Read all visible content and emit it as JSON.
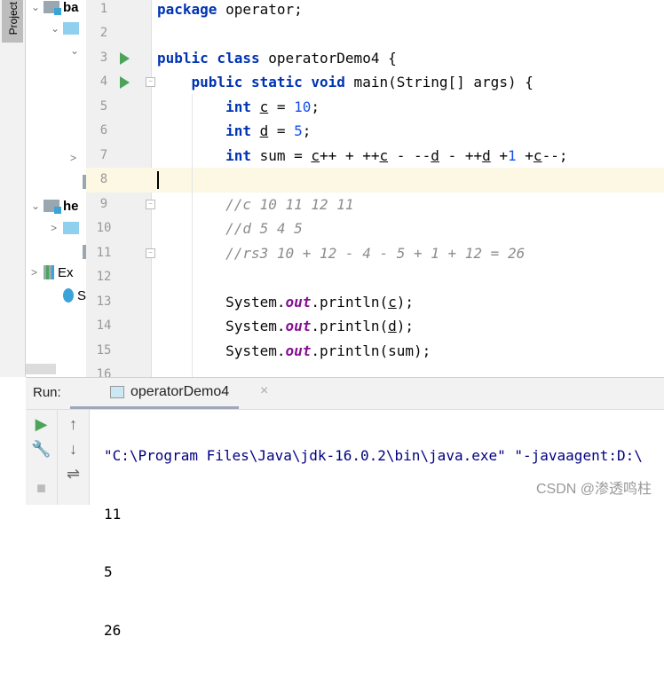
{
  "sidebar": {
    "project_tab": "Project",
    "tree": [
      {
        "label": "ba",
        "bold": true
      },
      {
        "label": "",
        "bold": false
      },
      {
        "label": "",
        "bold": false
      },
      {
        "label": "",
        "bold": false
      },
      {
        "label": "",
        "bold": false
      },
      {
        "label": "he",
        "bold": true
      },
      {
        "label": "",
        "bold": false
      },
      {
        "label": "",
        "bold": false
      },
      {
        "label": "Ex",
        "bold": false
      },
      {
        "label": "Sc",
        "bold": false
      }
    ]
  },
  "editor": {
    "current_line": 8,
    "run_lines": [
      3,
      4
    ],
    "lines": [
      [
        {
          "t": "package",
          "c": "kw"
        },
        {
          "t": " operator;"
        }
      ],
      [],
      [
        {
          "t": "public class",
          "c": "kw"
        },
        {
          "t": " operatorDemo4 {"
        }
      ],
      [
        {
          "t": "    "
        },
        {
          "t": "public static void",
          "c": "kw"
        },
        {
          "t": " main(String[] args) {"
        }
      ],
      [
        {
          "t": "        "
        },
        {
          "t": "int",
          "c": "kw"
        },
        {
          "t": " "
        },
        {
          "t": "c",
          "c": "ul"
        },
        {
          "t": " = "
        },
        {
          "t": "10",
          "c": "num"
        },
        {
          "t": ";"
        }
      ],
      [
        {
          "t": "        "
        },
        {
          "t": "int",
          "c": "kw"
        },
        {
          "t": " "
        },
        {
          "t": "d",
          "c": "ul"
        },
        {
          "t": " = "
        },
        {
          "t": "5",
          "c": "num"
        },
        {
          "t": ";"
        }
      ],
      [
        {
          "t": "        "
        },
        {
          "t": "int",
          "c": "kw"
        },
        {
          "t": " sum = "
        },
        {
          "t": "c",
          "c": "ul"
        },
        {
          "t": "++ + ++"
        },
        {
          "t": "c",
          "c": "ul"
        },
        {
          "t": " - --"
        },
        {
          "t": "d",
          "c": "ul"
        },
        {
          "t": " - ++"
        },
        {
          "t": "d",
          "c": "ul"
        },
        {
          "t": " +"
        },
        {
          "t": "1",
          "c": "num"
        },
        {
          "t": " +"
        },
        {
          "t": "c",
          "c": "ul"
        },
        {
          "t": "--;"
        }
      ],
      [],
      [
        {
          "t": "        "
        },
        {
          "t": "//c 10 11 12 11",
          "c": "cm"
        }
      ],
      [
        {
          "t": "        "
        },
        {
          "t": "//d 5 4 5",
          "c": "cm"
        }
      ],
      [
        {
          "t": "        "
        },
        {
          "t": "//rs3 10 + 12 - 4 - 5 + 1 + 12 = 26",
          "c": "cm"
        }
      ],
      [],
      [
        {
          "t": "        System."
        },
        {
          "t": "out",
          "c": "st"
        },
        {
          "t": ".println("
        },
        {
          "t": "c",
          "c": "ul"
        },
        {
          "t": ");"
        }
      ],
      [
        {
          "t": "        System."
        },
        {
          "t": "out",
          "c": "st"
        },
        {
          "t": ".println("
        },
        {
          "t": "d",
          "c": "ul"
        },
        {
          "t": ");"
        }
      ],
      [
        {
          "t": "        System."
        },
        {
          "t": "out",
          "c": "st"
        },
        {
          "t": ".println(sum);"
        }
      ],
      [
        {
          "t": ""
        }
      ]
    ]
  },
  "run_panel": {
    "label": "Run:",
    "tab": "operatorDemo4",
    "output": [
      "\"C:\\Program Files\\Java\\jdk-16.0.2\\bin\\java.exe\" \"-javaagent:D:\\",
      "11",
      "5",
      "26"
    ],
    "command_color": "#000080"
  },
  "watermark": "CSDN @渗透鸣柱"
}
